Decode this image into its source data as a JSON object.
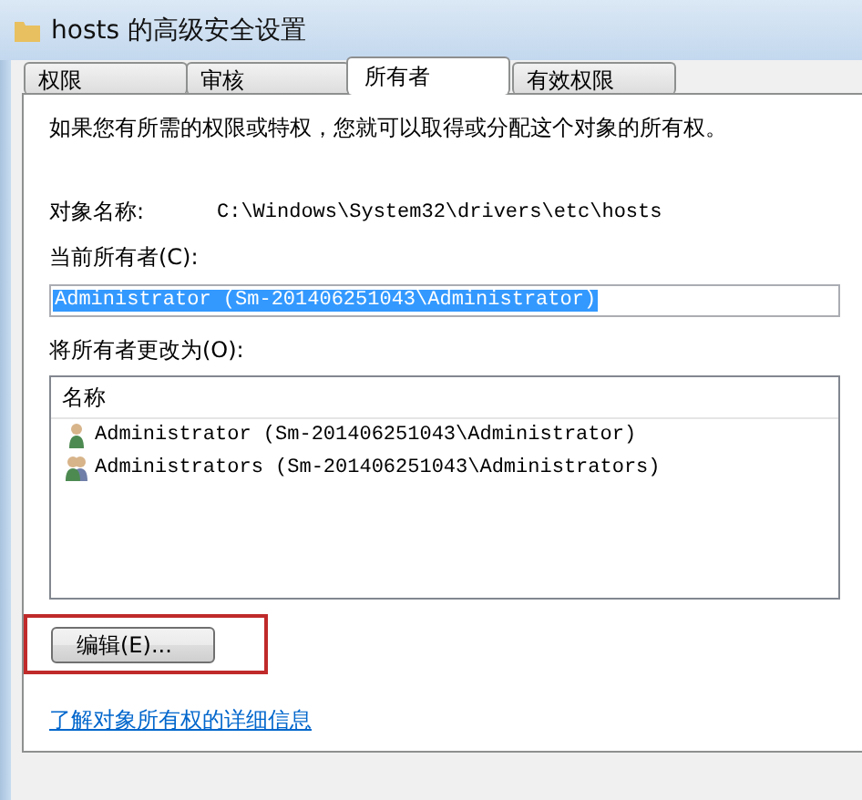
{
  "window": {
    "title": "hosts 的高级安全设置"
  },
  "tabs": [
    {
      "label": "权限",
      "selected": false
    },
    {
      "label": "审核",
      "selected": false
    },
    {
      "label": "所有者",
      "selected": true
    },
    {
      "label": "有效权限",
      "selected": false
    }
  ],
  "intro": "如果您有所需的权限或特权，您就可以取得或分配这个对象的所有权。",
  "object_name": {
    "label": "对象名称:",
    "value": "C:\\Windows\\System32\\drivers\\etc\\hosts"
  },
  "current_owner": {
    "label": "当前所有者(C):",
    "value": "Administrator (Sm-201406251043\\Administrator)",
    "selected": true
  },
  "change_owner": {
    "label": "将所有者更改为(O):",
    "columns": [
      "名称"
    ],
    "rows": [
      {
        "name": "Administrator (Sm-201406251043\\Administrator)",
        "kind": "user"
      },
      {
        "name": "Administrators (Sm-201406251043\\Administrators)",
        "kind": "group"
      }
    ]
  },
  "edit_button": "编辑(E)...",
  "link": "了解对象所有权的详细信息"
}
